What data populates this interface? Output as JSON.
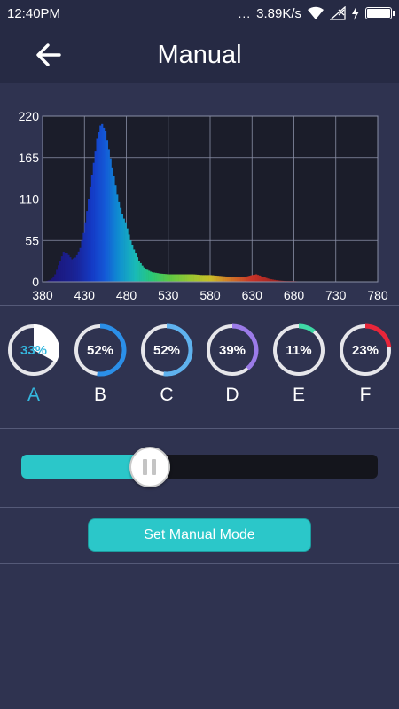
{
  "status_bar": {
    "time": "12:40PM",
    "network_speed": "3.89K/s",
    "dots": "...",
    "icons": [
      "wifi-icon",
      "signal-icon",
      "charging-icon",
      "battery-icon"
    ]
  },
  "header": {
    "title": "Manual",
    "back_icon": "arrow-left-icon"
  },
  "chart_data": {
    "type": "area",
    "title": "",
    "xlabel": "",
    "ylabel": "",
    "xlim": [
      380,
      780
    ],
    "ylim": [
      0,
      220
    ],
    "x_ticks": [
      "380",
      "430",
      "480",
      "530",
      "580",
      "630",
      "680",
      "730",
      "780"
    ],
    "y_ticks": [
      "0",
      "55",
      "110",
      "165",
      "220"
    ],
    "grid": true,
    "x": [
      380,
      385,
      390,
      395,
      400,
      405,
      410,
      415,
      420,
      425,
      430,
      435,
      440,
      445,
      450,
      455,
      460,
      465,
      470,
      475,
      480,
      485,
      490,
      495,
      500,
      505,
      510,
      520,
      530,
      540,
      550,
      560,
      570,
      580,
      590,
      600,
      610,
      620,
      630,
      635,
      640,
      650,
      660,
      670,
      680,
      690,
      700,
      720,
      740,
      760,
      780
    ],
    "y": [
      0,
      1,
      3,
      10,
      25,
      40,
      37,
      30,
      33,
      45,
      70,
      110,
      150,
      190,
      212,
      200,
      170,
      140,
      110,
      90,
      75,
      55,
      40,
      28,
      20,
      16,
      13,
      11,
      10,
      10,
      10,
      10,
      9,
      9,
      8,
      7,
      6,
      6,
      9,
      10,
      8,
      4,
      2,
      1,
      1,
      0,
      0,
      0,
      0,
      0,
      0
    ]
  },
  "channels": [
    {
      "letter": "A",
      "percent": 33,
      "label": "33%",
      "color": "#ffffff",
      "active": true
    },
    {
      "letter": "B",
      "percent": 52,
      "label": "52%",
      "color": "#2b8fe8",
      "active": false
    },
    {
      "letter": "C",
      "percent": 52,
      "label": "52%",
      "color": "#5fb2ee",
      "active": false
    },
    {
      "letter": "D",
      "percent": 39,
      "label": "39%",
      "color": "#9b7be8",
      "active": false
    },
    {
      "letter": "E",
      "percent": 11,
      "label": "11%",
      "color": "#3fd9a6",
      "active": false
    },
    {
      "letter": "F",
      "percent": 23,
      "label": "23%",
      "color": "#e8263a",
      "active": false
    }
  ],
  "slider": {
    "value": 33,
    "max": 100
  },
  "actions": {
    "set_manual_label": "Set Manual Mode"
  },
  "colors": {
    "background": "#2f3350",
    "header": "#262a44",
    "accent": "#2bc7c9",
    "active_text": "#35b7de"
  }
}
